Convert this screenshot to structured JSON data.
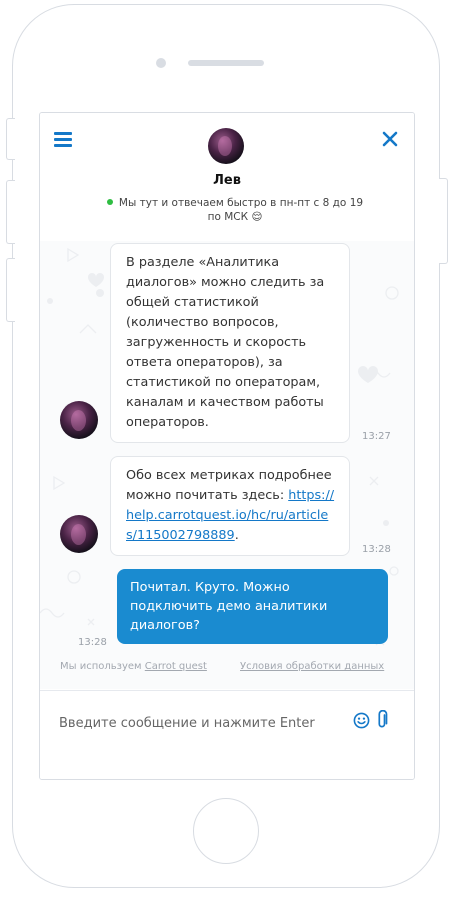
{
  "colors": {
    "accent": "#1478c8",
    "outgoing_bubble": "#1a8bd0",
    "online": "#2fbd42"
  },
  "header": {
    "menu_icon": "hamburger-menu-icon",
    "close_icon": "close-icon",
    "agent_name": "Лев",
    "status_text": "Мы тут и отвечаем быстро в пн-пт с 8 до 19 по МСК",
    "status_emoji": "😌"
  },
  "messages": [
    {
      "direction": "incoming",
      "text": "В разделе «Аналитика диалогов» можно следить за общей статистикой (количество вопросов, загруженность и скорость ответа операторов), за статистикой по операторам, каналам и качеством работы операторов.",
      "time": "13:27"
    },
    {
      "direction": "incoming",
      "text_before": "Обо всех метриках подробнее можно почитать здесь: ",
      "link": "https://help.carrotquest.io/hc/ru/articles/115002798889",
      "text_after": ".",
      "time": "13:28"
    },
    {
      "direction": "outgoing",
      "text": "Почитал. Круто. Можно подключить демо аналитики диалогов?",
      "time": "13:28"
    }
  ],
  "footer": {
    "powered_prefix": "Мы используем ",
    "powered_brand": "Carrot quest",
    "privacy_link": "Условия обработки данных"
  },
  "composer": {
    "placeholder": "Введите сообщение и нажмите Enter",
    "emoji_icon": "smiley-icon",
    "attach_icon": "paperclip-icon"
  }
}
